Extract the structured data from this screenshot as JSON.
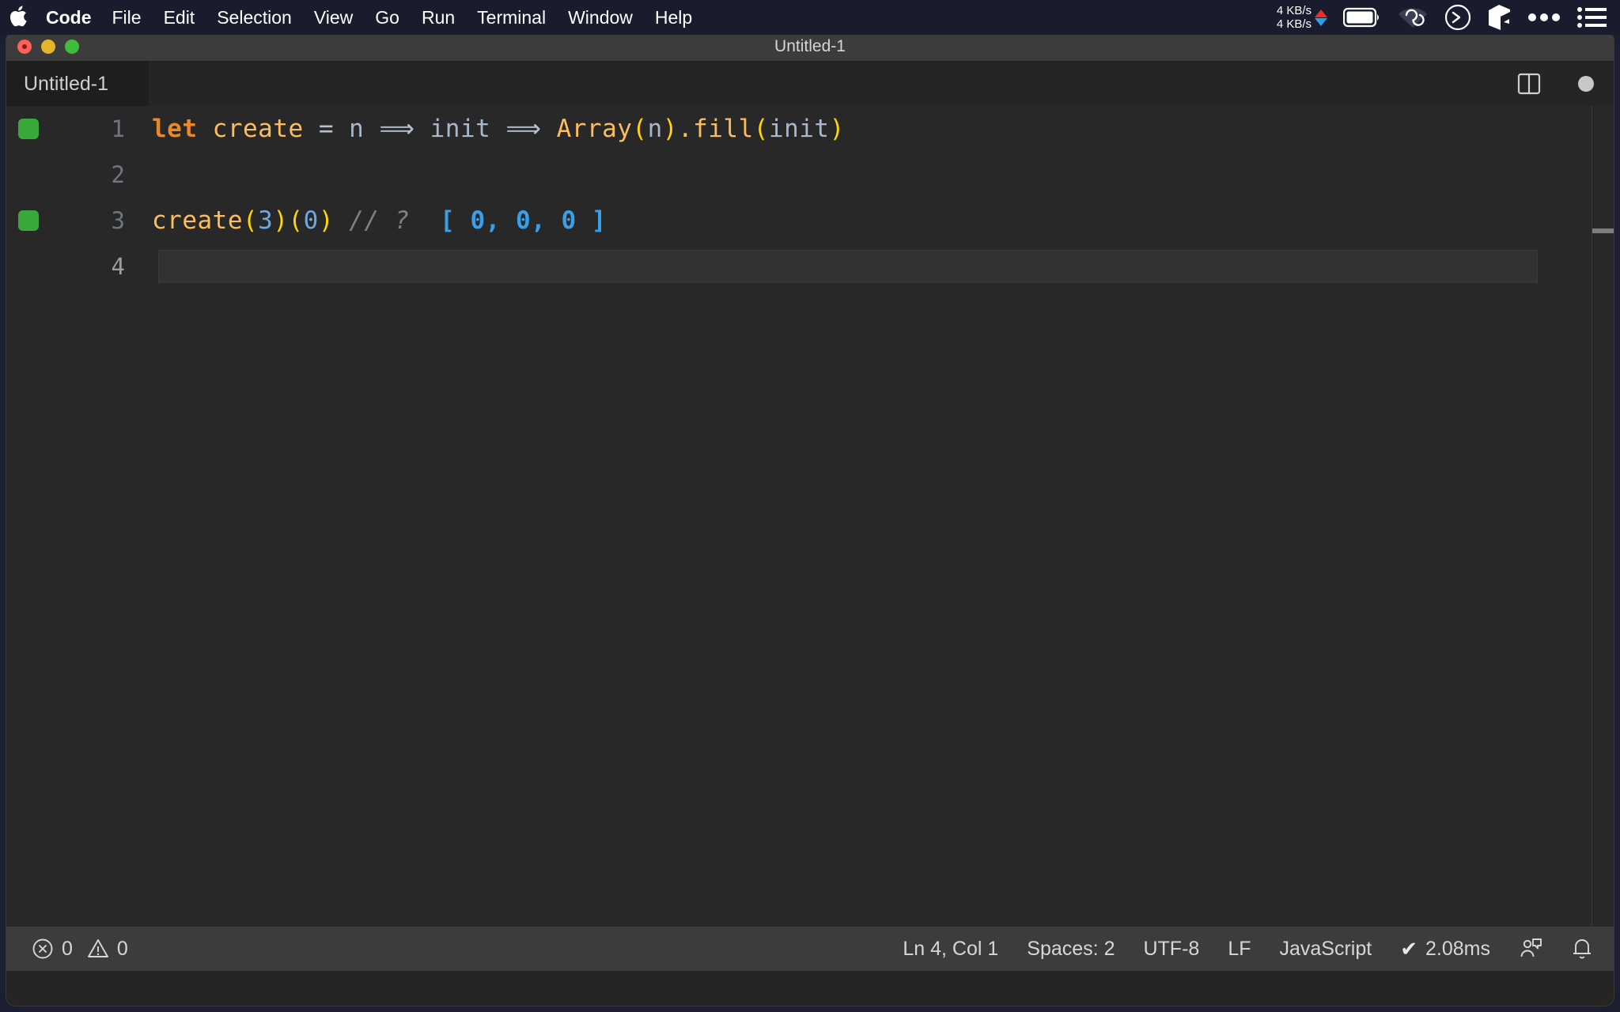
{
  "menubar": {
    "apple_icon": "apple-logo-icon",
    "items": [
      {
        "label": "Code",
        "bold": true
      },
      {
        "label": "File",
        "bold": false
      },
      {
        "label": "Edit",
        "bold": false
      },
      {
        "label": "Selection",
        "bold": false
      },
      {
        "label": "View",
        "bold": false
      },
      {
        "label": "Go",
        "bold": false
      },
      {
        "label": "Run",
        "bold": false
      },
      {
        "label": "Terminal",
        "bold": false
      },
      {
        "label": "Window",
        "bold": false
      },
      {
        "label": "Help",
        "bold": false
      }
    ],
    "status": {
      "net_up": "4 KB/s",
      "net_down": "4 KB/s",
      "up_arrow_color": "#e8312a",
      "down_arrow_color": "#2e9ce8",
      "icons": [
        "battery-icon",
        "wifi-vpn-icon",
        "shell-prompt-icon",
        "cube-icon",
        "ellipsis-icon",
        "control-center-icon"
      ]
    }
  },
  "window": {
    "title": "Untitled-1",
    "traffic_lights": [
      "close-button",
      "minimize-button",
      "maximize-button"
    ]
  },
  "tabbar": {
    "tabs": [
      {
        "label": "Untitled-1",
        "active": true
      }
    ],
    "actions": [
      "split-editor-icon",
      "more-actions-icon"
    ]
  },
  "editor": {
    "language": "JavaScript",
    "active_line": 4,
    "lines": [
      {
        "number": "1",
        "has_marker": true,
        "active": false,
        "tokens": [
          {
            "text": "let",
            "cls": "t-key"
          },
          {
            "text": " ",
            "cls": "t-op"
          },
          {
            "text": "create",
            "cls": "t-fn"
          },
          {
            "text": " ",
            "cls": "t-op"
          },
          {
            "text": "=",
            "cls": "t-op"
          },
          {
            "text": " ",
            "cls": "t-op"
          },
          {
            "text": "n",
            "cls": "t-var"
          },
          {
            "text": " ",
            "cls": "t-op"
          },
          {
            "text": "⟹",
            "cls": "t-op"
          },
          {
            "text": " ",
            "cls": "t-op"
          },
          {
            "text": "init",
            "cls": "t-var"
          },
          {
            "text": " ",
            "cls": "t-op"
          },
          {
            "text": "⟹",
            "cls": "t-op"
          },
          {
            "text": " ",
            "cls": "t-op"
          },
          {
            "text": "Array",
            "cls": "t-fn"
          },
          {
            "text": "(",
            "cls": "t-paren"
          },
          {
            "text": "n",
            "cls": "t-var"
          },
          {
            "text": ")",
            "cls": "t-paren"
          },
          {
            "text": ".",
            "cls": "t-fn"
          },
          {
            "text": "fill",
            "cls": "t-fn"
          },
          {
            "text": "(",
            "cls": "t-paren"
          },
          {
            "text": "init",
            "cls": "t-var"
          },
          {
            "text": ")",
            "cls": "t-paren"
          }
        ]
      },
      {
        "number": "2",
        "has_marker": false,
        "active": false,
        "tokens": []
      },
      {
        "number": "3",
        "has_marker": true,
        "active": false,
        "tokens": [
          {
            "text": "create",
            "cls": "t-fn"
          },
          {
            "text": "(",
            "cls": "t-paren"
          },
          {
            "text": "3",
            "cls": "t-num"
          },
          {
            "text": ")",
            "cls": "t-paren"
          },
          {
            "text": "(",
            "cls": "t-paren"
          },
          {
            "text": "0",
            "cls": "t-num"
          },
          {
            "text": ")",
            "cls": "t-paren"
          },
          {
            "text": " ",
            "cls": "t-op"
          },
          {
            "text": "// ?",
            "cls": "t-comment"
          },
          {
            "text": "  ",
            "cls": "t-op"
          },
          {
            "text": "[ 0, 0, 0 ]",
            "cls": "t-result"
          }
        ]
      },
      {
        "number": "4",
        "has_marker": false,
        "active": true,
        "tokens": []
      }
    ]
  },
  "statusbar": {
    "errors_icon": "error-circle-icon",
    "errors": "0",
    "warnings_icon": "warning-triangle-icon",
    "warnings": "0",
    "cursor_position": "Ln 4, Col 1",
    "indentation": "Spaces: 2",
    "encoding": "UTF-8",
    "eol": "LF",
    "language_mode": "JavaScript",
    "run_check": "✔",
    "run_time": "2.08ms",
    "right_icons": [
      "feedback-icon",
      "notifications-bell-icon"
    ]
  }
}
